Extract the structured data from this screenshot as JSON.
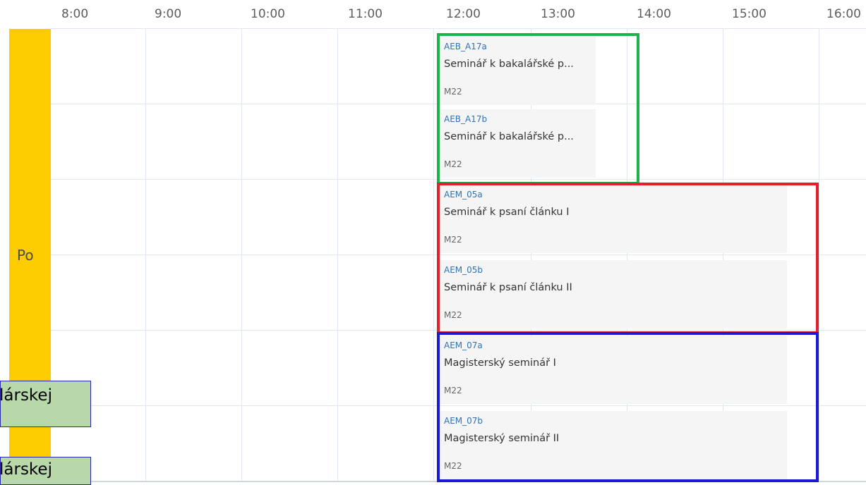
{
  "hours": [
    "8:00",
    "9:00",
    "10:00",
    "11:00",
    "12:00",
    "13:00",
    "14:00",
    "15:00",
    "16:00"
  ],
  "day": {
    "label": "Po",
    "color": "#fccb00"
  },
  "events": [
    {
      "code": "AEB_A17a",
      "name": "Seminář k bakalářské p...",
      "room": "M22"
    },
    {
      "code": "AEB_A17b",
      "name": "Seminář k bakalářské p...",
      "room": "M22"
    },
    {
      "code": "AEM_05a",
      "name": "Seminář k psaní článku I",
      "room": "M22"
    },
    {
      "code": "AEM_05b",
      "name": "Seminář k psaní článku II",
      "room": "M22"
    },
    {
      "code": "AEM_07a",
      "name": "Magisterský seminář I",
      "room": "M22"
    },
    {
      "code": "AEM_07b",
      "name": "Magisterský seminář II",
      "room": "M22"
    }
  ],
  "highlights": {
    "green": "#1bb34a",
    "red": "#e3202d",
    "blue": "#1a1ad6"
  },
  "overlays": [
    "lárskej",
    "lárskej"
  ]
}
